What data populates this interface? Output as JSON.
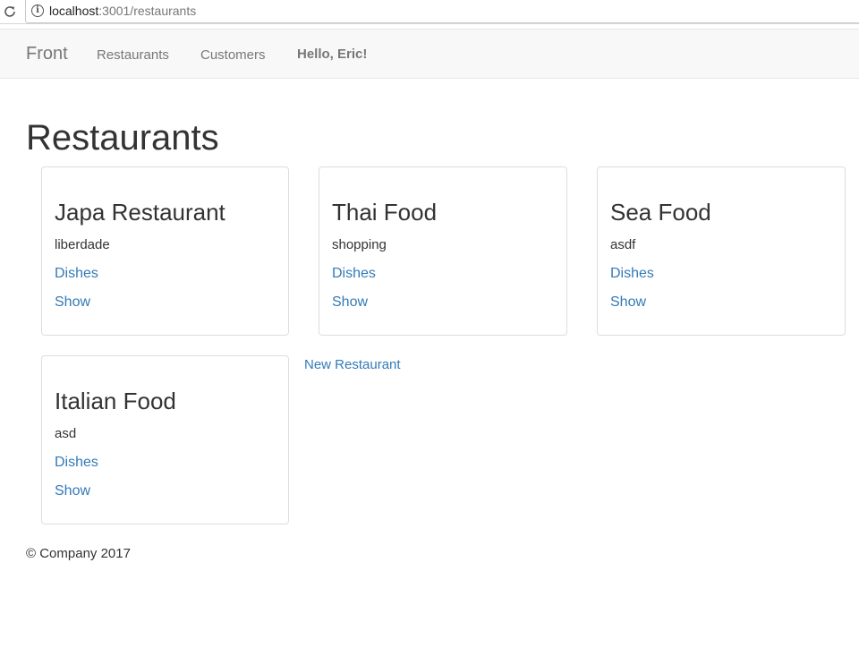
{
  "browser": {
    "url_host": "localhost",
    "url_path": ":3001/restaurants",
    "info_symbol": "i"
  },
  "navbar": {
    "brand": "Front",
    "links": [
      {
        "label": "Restaurants"
      },
      {
        "label": "Customers"
      }
    ],
    "greeting": "Hello, Eric!"
  },
  "main": {
    "title": "Restaurants",
    "restaurants": [
      {
        "name": "Japa Restaurant",
        "location": "liberdade",
        "dishes_label": "Dishes",
        "show_label": "Show"
      },
      {
        "name": "Thai Food",
        "location": "shopping",
        "dishes_label": "Dishes",
        "show_label": "Show"
      },
      {
        "name": "Sea Food",
        "location": "asdf",
        "dishes_label": "Dishes",
        "show_label": "Show"
      },
      {
        "name": "Italian Food",
        "location": "asd",
        "dishes_label": "Dishes",
        "show_label": "Show"
      }
    ],
    "new_restaurant_label": "New Restaurant"
  },
  "footer": {
    "text": "© Company 2017"
  },
  "colors": {
    "link": "#337ab7",
    "navbar_bg": "#f8f8f8",
    "nav_text": "#777777",
    "text": "#333333"
  },
  "icons": [
    "reload-icon",
    "info-icon"
  ]
}
